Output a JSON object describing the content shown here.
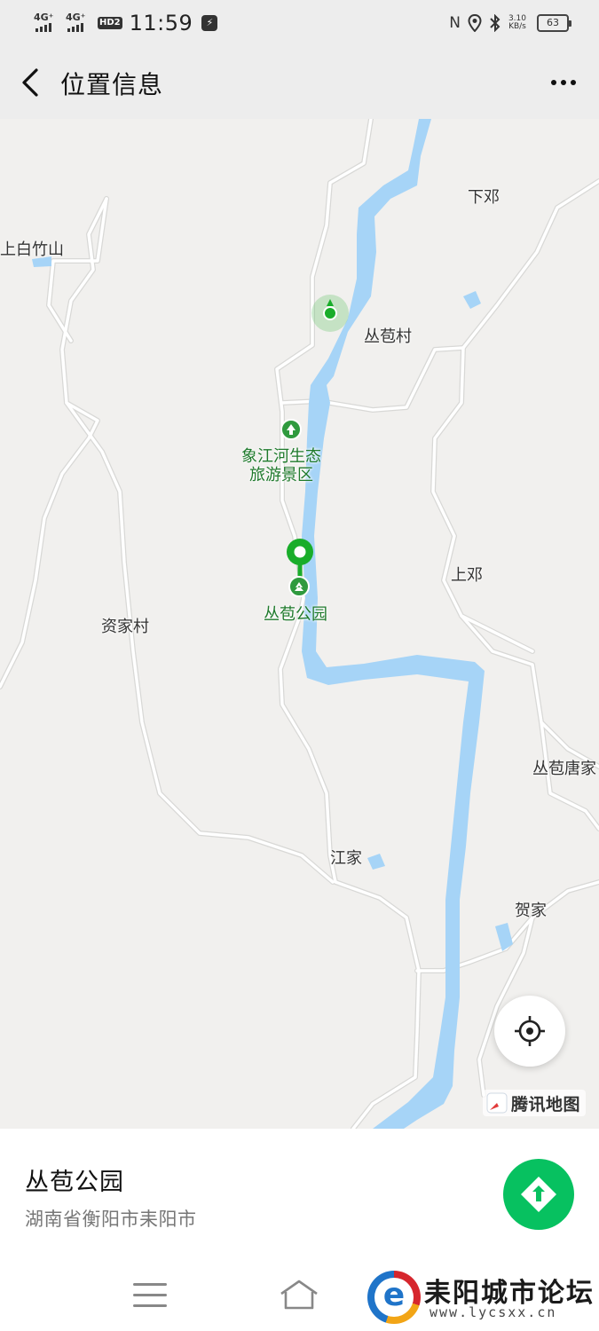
{
  "status_bar": {
    "network_1": "4G⁺",
    "network_2": "4G⁺",
    "hd_badge": "HD2",
    "time": "11:59",
    "net_speed_value": "3.10",
    "net_speed_unit": "KB/s",
    "battery": "63",
    "icons": [
      "nfc-icon",
      "location-icon",
      "bluetooth-icon",
      "battery-icon"
    ]
  },
  "header": {
    "title": "位置信息",
    "back_icon": "chevron-left-icon",
    "more_icon": "more-dots-icon"
  },
  "map": {
    "places": {
      "xiadeng": "下邓",
      "shangbaizhushan": "上白竹山",
      "congbaocun": "丛苞村",
      "shangdeng": "上邓",
      "zijiacun": "资家村",
      "congbaotangjia": "丛苞唐家",
      "jiangjia": "江家",
      "hejia": "贺家"
    },
    "pois": {
      "scenic_area": "象江河生态\n旅游景区",
      "park": "丛苞公园"
    },
    "brand": "腾讯地图",
    "colors": {
      "land": "#f1f0ee",
      "water": "#a6d4f7",
      "road": "#ffffff",
      "poi_green": "#2f9a3e",
      "pin_green": "#19ad2a"
    }
  },
  "info_panel": {
    "name": "丛苞公园",
    "address": "湖南省衡阳市耒阳市",
    "go_button_color": "#07c160"
  },
  "watermark": {
    "title": "耒阳城市论坛",
    "url": "www.lycsxx.cn"
  }
}
